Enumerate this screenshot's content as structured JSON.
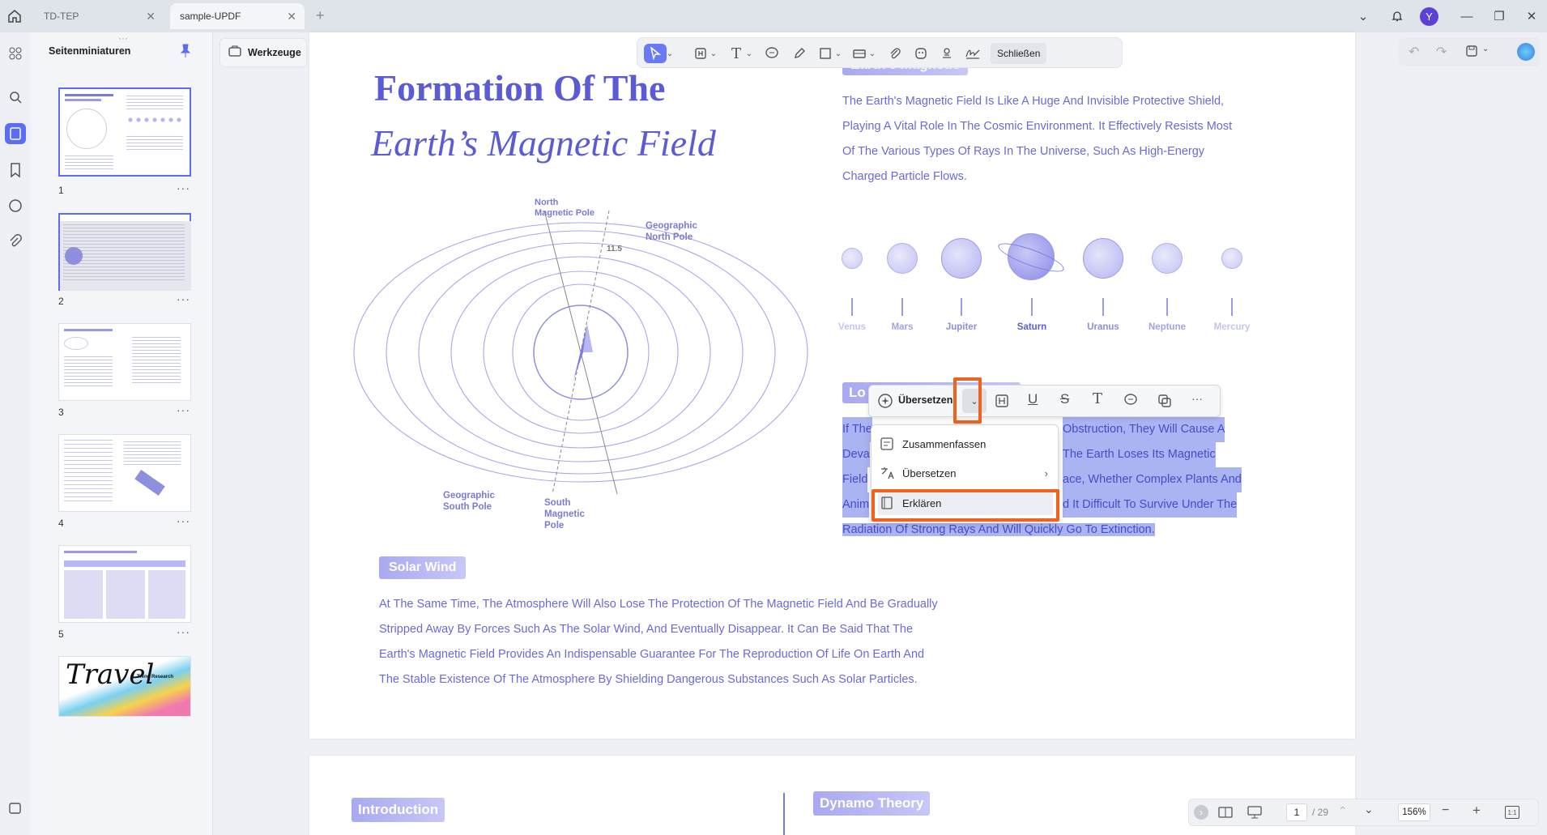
{
  "tabs": [
    {
      "label": "TD-TEP"
    },
    {
      "label": "sample-UPDF"
    }
  ],
  "user": {
    "avatar_letter": "Y"
  },
  "sidebar": {
    "title": "Seitenminiaturen",
    "thumb_numbers": [
      "1",
      "2",
      "3",
      "4",
      "5"
    ],
    "thumb5_logo": "Travel",
    "thumb5_sub": "Trend Research"
  },
  "tools_button": {
    "label": "Werkzeuge"
  },
  "toolbar": {
    "close_label": "Schließen"
  },
  "page1": {
    "title_line1": "Formation Of The",
    "title_line2": "Earth’s Magnetic Field",
    "section1_tag": "Earth's Magnetic",
    "section1_text": [
      "The Earth's Magnetic Field Is Like A Huge And Invisible Protective Shield,",
      "Playing A Vital Role In The Cosmic Environment. It Effectively Resists Most",
      "Of The Various Types Of Rays In The Universe, Such As High-Energy",
      "Charged Particle Flows."
    ],
    "planets": [
      "Venus",
      "Mars",
      "Jupiter",
      "Saturn",
      "Uranus",
      "Neptune",
      "Mercury"
    ],
    "diagram_labels": {
      "north_magnetic": "North\nMagnetic Pole",
      "geo_north": "Geographic\nNorth Pole",
      "angle": "11.5",
      "geo_south": "Geographic\nSouth Pole",
      "south_magnetic": "South\nMagnetic\nPole"
    },
    "section2_tag_partial": "Lo",
    "section2_text": [
      "If The",
      "Obstruction, They Will Cause A",
      "Deva",
      "The Earth Loses Its Magnetic",
      "Field",
      "ace, Whether Complex Plants And",
      "Anim",
      "d It Difficult To Survive Under The",
      "Radiation Of Strong Rays And Will Quickly Go To Extinction."
    ],
    "solar_tag": "Solar Wind",
    "solar_text": [
      "At The Same Time, The Atmosphere Will Also Lose The Protection Of The Magnetic Field And Be Gradually",
      "Stripped Away By Forces Such As The Solar Wind, And Eventually Disappear. It Can Be Said That The",
      "Earth's Magnetic Field Provides An Indispensable Guarantee For The Reproduction Of Life On Earth And",
      "The Stable Existence Of The Atmosphere By Shielding Dangerous Substances Such As Solar Particles."
    ]
  },
  "page2": {
    "intro_tag": "Introduction",
    "dynamo_tag": "Dynamo Theory"
  },
  "context_toolbar": {
    "translate_label": "Übersetzen"
  },
  "context_menu": {
    "items": [
      {
        "label": "Zusammenfassen"
      },
      {
        "label": "Übersetzen"
      },
      {
        "label": "Erklären"
      }
    ]
  },
  "bottom": {
    "page_current": "1",
    "page_total": "/ 29",
    "zoom": "156%"
  }
}
